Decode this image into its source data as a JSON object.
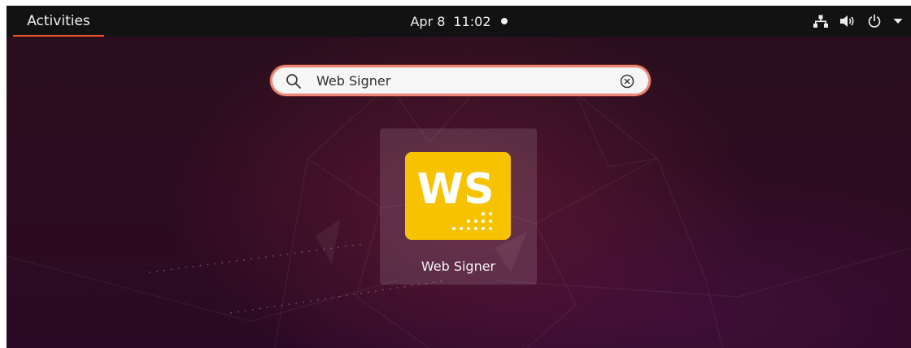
{
  "topbar": {
    "activities_label": "Activities",
    "date": "Apr 8",
    "time": "11:02",
    "icons": [
      "network-icon",
      "volume-icon",
      "power-icon",
      "chevron-down-icon"
    ]
  },
  "search": {
    "value": "Web Signer",
    "icons": [
      "search-icon",
      "clear-icon"
    ]
  },
  "results": [
    {
      "label": "Web Signer",
      "icon_text": "WS",
      "icon_color": "#f7c200"
    }
  ],
  "colors": {
    "topbar_bg": "#121212",
    "accent": "#e95420",
    "search_border": "#e98a78",
    "icon_yellow": "#f7c200"
  }
}
